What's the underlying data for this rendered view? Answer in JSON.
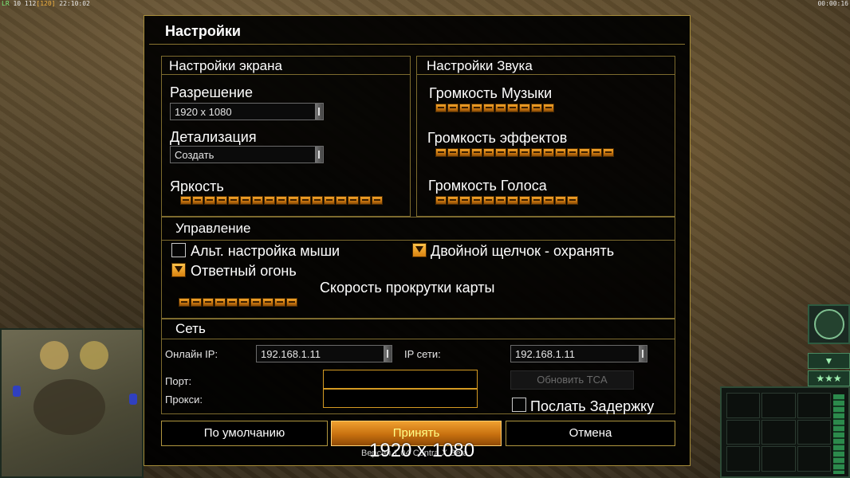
{
  "hud": {
    "top_left_green": "LR",
    "top_left_white": "10 112",
    "top_left_orange": "[120]",
    "top_left_time": "22:10:02",
    "top_right_time": "00:00:16"
  },
  "dialog": {
    "title": "Настройки",
    "display": {
      "header": "Настройки экрана",
      "resolution_label": "Разрешение",
      "resolution_value": "1920 x 1080",
      "detail_label": "Детализация",
      "detail_value": "Создать",
      "brightness_label": "Яркость",
      "brightness_level": 1.0
    },
    "sound": {
      "header": "Настройки Звука",
      "music_label": "Громкость Музыки",
      "music_level": 0.67,
      "effects_label": "Громкость эффектов",
      "effects_level": 1.0,
      "voice_label": "Громкость Голоса",
      "voice_level": 0.8
    },
    "controls": {
      "header": "Управление",
      "alt_mouse_label": "Альт. настройка мыши",
      "alt_mouse_checked": false,
      "double_click_label": "Двойной щелчок - охранять",
      "double_click_checked": true,
      "return_fire_label": "Ответный огонь",
      "return_fire_checked": true,
      "scroll_speed_label": "Скорость прокрутки карты",
      "scroll_speed_level": 0.625
    },
    "network": {
      "header": "Сеть",
      "online_ip_label": "Онлайн IP:",
      "online_ip_value": "192.168.1.11",
      "lan_ip_label": "IP сети:",
      "lan_ip_value": "192.168.1.11",
      "port_label": "Порт:",
      "port_value": "",
      "proxy_label": "Прокси:",
      "proxy_value": "",
      "update_button": "Обновить TCA",
      "send_delay_label": "Послать Задержку",
      "send_delay_checked": false
    },
    "buttons": {
      "defaults": "По умолчанию",
      "accept": "Принять",
      "cancel": "Отмена"
    }
  },
  "overlay_resolution": "1920 x 1080",
  "version_text": "Версия 1.04 Contra X Beta",
  "colors": {
    "accent_orange": "#e08a1c",
    "border_gold": "#a78d3a",
    "panel_bg": "#000000"
  }
}
